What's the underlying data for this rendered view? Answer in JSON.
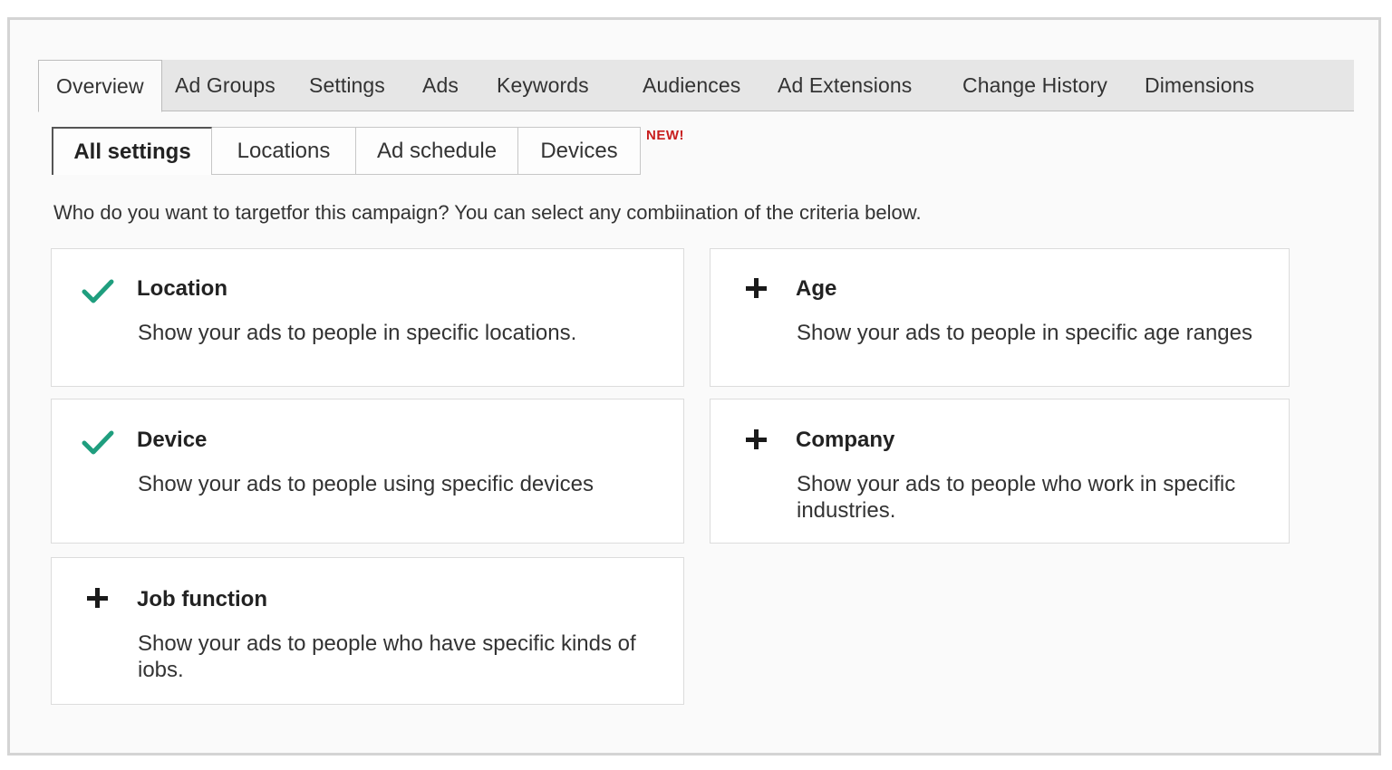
{
  "main_tabs": [
    {
      "label": "Overview",
      "active": true
    },
    {
      "label": "Ad Groups"
    },
    {
      "label": "Settings"
    },
    {
      "label": "Ads"
    },
    {
      "label": "Keywords"
    },
    {
      "label": "Audiences"
    },
    {
      "label": "Ad Extensions"
    },
    {
      "label": "Change History"
    },
    {
      "label": "Dimensions"
    }
  ],
  "sub_tabs": [
    {
      "label": "All settings",
      "active": true
    },
    {
      "label": "Locations"
    },
    {
      "label": "Ad schedule"
    },
    {
      "label": "Devices"
    }
  ],
  "new_badge": "NEW!",
  "intro": "Who do you want to targetfor this campaign? You can select any combiination of the criteria below.",
  "cards": [
    {
      "title": "Location",
      "desc": "Show your ads to people in specific locations.",
      "icon": "check-icon",
      "selected": true
    },
    {
      "title": "Age",
      "desc": "Show your ads to people in specific age ranges",
      "icon": "plus-icon",
      "selected": false
    },
    {
      "title": "Device",
      "desc": "Show your ads to people using specific devices",
      "icon": "check-icon",
      "selected": true
    },
    {
      "title": "Company",
      "desc": "Show your ads to people who work in specific industries.",
      "icon": "plus-icon",
      "selected": false
    },
    {
      "title": "Job function",
      "desc": "Show your ads to people who have specific kinds of iobs.",
      "icon": "plus-icon",
      "selected": false
    }
  ],
  "colors": {
    "check": "#1f9e7e",
    "plus": "#1a1a1a",
    "new_badge": "#c81e1e"
  }
}
